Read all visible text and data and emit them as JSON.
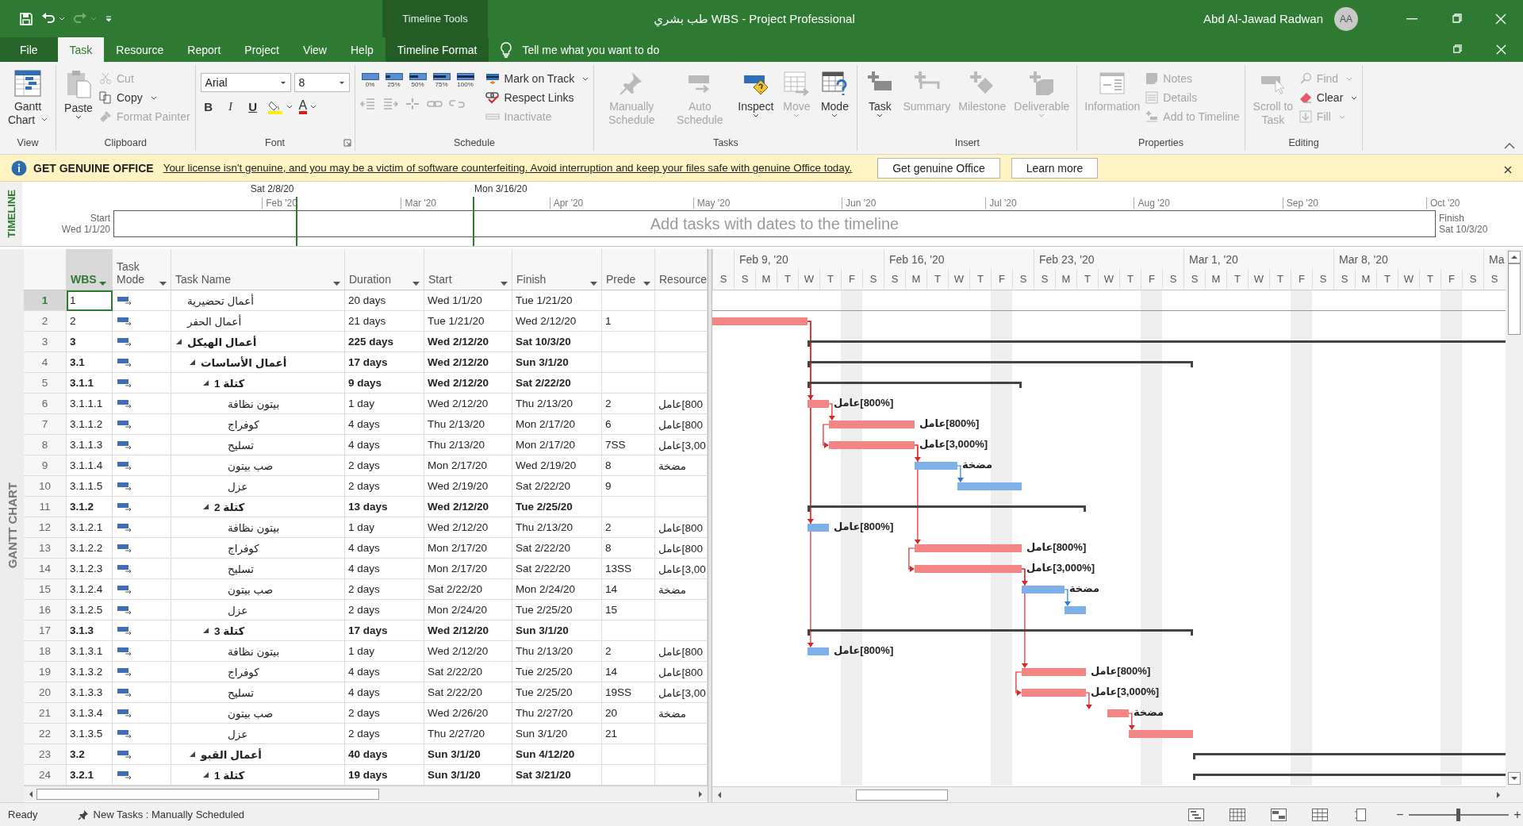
{
  "title_bar": {
    "context_label": "Timeline Tools",
    "title": "طب بشري WBS  -  Project Professional",
    "user": "Abd Al-Jawad Radwan",
    "avatar": "AA"
  },
  "menu_tabs": [
    {
      "label": "File",
      "kind": "file",
      "selected": false
    },
    {
      "label": "Task",
      "kind": "tab",
      "selected": true
    },
    {
      "label": "Resource",
      "kind": "tab",
      "selected": false
    },
    {
      "label": "Report",
      "kind": "tab",
      "selected": false
    },
    {
      "label": "Project",
      "kind": "tab",
      "selected": false
    },
    {
      "label": "View",
      "kind": "tab",
      "selected": false
    },
    {
      "label": "Help",
      "kind": "tab",
      "selected": false
    },
    {
      "label": "Timeline Format",
      "kind": "context",
      "selected": false
    }
  ],
  "tell_me": {
    "placeholder": "Tell me what you want to do"
  },
  "ribbon": {
    "view": {
      "label": "View",
      "gantt_chart": {
        "label": "Gantt Chart",
        "disabled": false
      }
    },
    "clipboard": {
      "label": "Clipboard",
      "paste": {
        "label": "Paste",
        "disabled": false
      },
      "cut": {
        "label": "Cut",
        "disabled": true
      },
      "copy": {
        "label": "Copy",
        "disabled": false
      },
      "format_painter": {
        "label": "Format Painter",
        "disabled": true
      }
    },
    "font": {
      "label": "Font",
      "font_name": {
        "value": "Arial"
      },
      "font_size": {
        "value": "8"
      },
      "bold": {
        "label": "B"
      },
      "italic": {
        "label": "I"
      },
      "underline": {
        "label": "U"
      },
      "font_color": {
        "label": "A"
      }
    },
    "schedule": {
      "label": "Schedule",
      "percent": [
        {
          "label": "0%"
        },
        {
          "label": "25%"
        },
        {
          "label": "50%"
        },
        {
          "label": "75%"
        },
        {
          "label": "100%"
        }
      ],
      "mark_on_track": {
        "label": "Mark on Track",
        "disabled": false
      },
      "respect_links": {
        "label": "Respect Links",
        "disabled": false
      },
      "inactivate": {
        "label": "Inactivate",
        "disabled": true
      },
      "outdent": {
        "disabled": true
      },
      "indent": {
        "disabled": true
      },
      "split": {
        "disabled": true
      },
      "link": {
        "disabled": true
      },
      "unlink": {
        "disabled": true
      }
    },
    "tasks": {
      "label": "Tasks",
      "manually_schedule": {
        "label": "Manually Schedule",
        "disabled": true
      },
      "auto_schedule": {
        "label": "Auto Schedule",
        "disabled": true
      },
      "inspect": {
        "label": "Inspect",
        "disabled": false
      },
      "move": {
        "label": "Move",
        "disabled": true
      },
      "mode": {
        "label": "Mode",
        "disabled": false
      }
    },
    "insert": {
      "label": "Insert",
      "task": {
        "label": "Task",
        "disabled": false
      },
      "summary": {
        "label": "Summary",
        "disabled": true
      },
      "milestone": {
        "label": "Milestone",
        "disabled": true
      },
      "deliverable": {
        "label": "Deliverable",
        "disabled": true
      }
    },
    "properties": {
      "label": "Properties",
      "information": {
        "label": "Information",
        "disabled": true
      },
      "notes": {
        "label": "Notes",
        "disabled": true
      },
      "details": {
        "label": "Details",
        "disabled": true
      },
      "add_to_timeline": {
        "label": "Add to Timeline",
        "disabled": true
      }
    },
    "editing": {
      "label": "Editing",
      "scroll_to_task": {
        "label": "Scroll to Task",
        "disabled": true
      },
      "find": {
        "label": "Find",
        "disabled": true
      },
      "clear": {
        "label": "Clear",
        "disabled": false
      },
      "fill": {
        "label": "Fill",
        "disabled": true
      }
    }
  },
  "banner": {
    "title": "GET GENUINE OFFICE",
    "message": "Your license isn't genuine, and you may be a victim of software counterfeiting. Avoid interruption and keep your files safe with genuine Office today.",
    "buttons": [
      "Get genuine Office",
      "Learn more"
    ]
  },
  "timeline": {
    "side_label": "TIMELINE",
    "start": {
      "label": "Start",
      "date": "Wed 1/1/20"
    },
    "finish": {
      "label": "Finish",
      "date": "Sat 10/3/20"
    },
    "months": [
      "Feb '20",
      "Mar '20",
      "Apr '20",
      "May '20",
      "Jun '20",
      "Jul '20",
      "Aug '20",
      "Sep '20",
      "Oct '20"
    ],
    "view_start": "Sat 2/8/20",
    "view_end": "Mon 3/16/20",
    "placeholder": "Add tasks with dates to the timeline"
  },
  "view_label": "GANTT CHART",
  "columns": [
    {
      "label": "WBS"
    },
    {
      "label": "Task Mode"
    },
    {
      "label": "Task Name"
    },
    {
      "label": "Duration"
    },
    {
      "label": "Start"
    },
    {
      "label": "Finish"
    },
    {
      "label": "Prede"
    },
    {
      "label": "Resource"
    }
  ],
  "tasks": [
    {
      "id": "1",
      "wbs": "1",
      "name": "أعمال تحضيرية",
      "kind": "task",
      "duration": "20 days",
      "start": "Wed 1/1/20",
      "finish": "Tue 1/21/20",
      "selected": true
    },
    {
      "id": "2",
      "wbs": "2",
      "name": "أعمال الحفر",
      "kind": "task",
      "duration": "21 days",
      "start": "Tue 1/21/20",
      "finish": "Wed 2/12/20",
      "pred": "1",
      "critical": true,
      "selected": false
    },
    {
      "id": "3",
      "wbs": "3",
      "name": "أعمال الهيكل",
      "kind": "summary",
      "expanded": true,
      "duration": "225 days",
      "start": "Wed 2/12/20",
      "finish": "Sat 10/3/20",
      "selected": false,
      "children": [
        {
          "id": "4",
          "wbs": "3.1",
          "name": "أعمال الأساسات",
          "kind": "summary",
          "expanded": true,
          "duration": "17 days",
          "start": "Wed 2/12/20",
          "finish": "Sun 3/1/20",
          "selected": false,
          "children": [
            {
              "id": "5",
              "wbs": "3.1.1",
              "name": "كتلة 1",
              "kind": "summary",
              "expanded": true,
              "duration": "9 days",
              "start": "Wed 2/12/20",
              "finish": "Sat 2/22/20",
              "selected": false,
              "children": [
                {
                  "id": "6",
                  "wbs": "3.1.1.1",
                  "name": "بيتون نظافة",
                  "kind": "task",
                  "duration": "1 day",
                  "start": "Wed 2/12/20",
                  "finish": "Thu 2/13/20",
                  "pred": "2",
                  "resource": "800]عامل",
                  "bar_label": "[800%]عامل",
                  "critical": true,
                  "selected": false
                },
                {
                  "id": "7",
                  "wbs": "3.1.1.2",
                  "name": "كوفراج",
                  "kind": "task",
                  "duration": "4 days",
                  "start": "Thu 2/13/20",
                  "finish": "Mon 2/17/20",
                  "pred": "6",
                  "resource": "800]عامل",
                  "bar_label": "[800%]عامل",
                  "critical": true,
                  "selected": false
                },
                {
                  "id": "8",
                  "wbs": "3.1.1.3",
                  "name": "تسليح",
                  "kind": "task",
                  "duration": "4 days",
                  "start": "Thu 2/13/20",
                  "finish": "Mon 2/17/20",
                  "pred": "7SS",
                  "resource": "3,00]عامل",
                  "bar_label": "[3,000%]عامل",
                  "critical": true,
                  "selected": false
                },
                {
                  "id": "9",
                  "wbs": "3.1.1.4",
                  "name": "صب بيتون",
                  "kind": "task",
                  "duration": "2 days",
                  "start": "Mon 2/17/20",
                  "finish": "Wed 2/19/20",
                  "pred": "8",
                  "resource": "مضخة",
                  "bar_label": "مضخة",
                  "critical": false,
                  "selected": false
                },
                {
                  "id": "10",
                  "wbs": "3.1.1.5",
                  "name": "عزل",
                  "kind": "task",
                  "duration": "2 days",
                  "start": "Wed 2/19/20",
                  "finish": "Sat 2/22/20",
                  "pred": "9",
                  "critical": false,
                  "selected": false
                }
              ]
            },
            {
              "id": "11",
              "wbs": "3.1.2",
              "name": "كتلة 2",
              "kind": "summary",
              "expanded": true,
              "duration": "13 days",
              "start": "Wed 2/12/20",
              "finish": "Tue 2/25/20",
              "selected": false,
              "children": [
                {
                  "id": "12",
                  "wbs": "3.1.2.1",
                  "name": "بيتون نظافة",
                  "kind": "task",
                  "duration": "1 day",
                  "start": "Wed 2/12/20",
                  "finish": "Thu 2/13/20",
                  "pred": "2",
                  "resource": "800]عامل",
                  "bar_label": "[800%]عامل",
                  "critical": false,
                  "selected": false
                },
                {
                  "id": "13",
                  "wbs": "3.1.2.2",
                  "name": "كوفراج",
                  "kind": "task",
                  "duration": "4 days",
                  "start": "Mon 2/17/20",
                  "finish": "Sat 2/22/20",
                  "pred": "8",
                  "resource": "800]عامل",
                  "bar_label": "[800%]عامل",
                  "critical": true,
                  "selected": false
                },
                {
                  "id": "14",
                  "wbs": "3.1.2.3",
                  "name": "تسليح",
                  "kind": "task",
                  "duration": "4 days",
                  "start": "Mon 2/17/20",
                  "finish": "Sat 2/22/20",
                  "pred": "13SS",
                  "resource": "3,00]عامل",
                  "bar_label": "[3,000%]عامل",
                  "critical": true,
                  "selected": false
                },
                {
                  "id": "15",
                  "wbs": "3.1.2.4",
                  "name": "صب بيتون",
                  "kind": "task",
                  "duration": "2 days",
                  "start": "Sat 2/22/20",
                  "finish": "Mon 2/24/20",
                  "pred": "14",
                  "resource": "مضخة",
                  "bar_label": "مضخة",
                  "critical": false,
                  "selected": false
                },
                {
                  "id": "16",
                  "wbs": "3.1.2.5",
                  "name": "عزل",
                  "kind": "task",
                  "duration": "2 days",
                  "start": "Mon 2/24/20",
                  "finish": "Tue 2/25/20",
                  "pred": "15",
                  "critical": false,
                  "selected": false
                }
              ]
            },
            {
              "id": "17",
              "wbs": "3.1.3",
              "name": "كتلة 3",
              "kind": "summary",
              "expanded": true,
              "duration": "17 days",
              "start": "Wed 2/12/20",
              "finish": "Sun 3/1/20",
              "selected": false,
              "children": [
                {
                  "id": "18",
                  "wbs": "3.1.3.1",
                  "name": "بيتون نظافة",
                  "kind": "task",
                  "duration": "1 day",
                  "start": "Wed 2/12/20",
                  "finish": "Thu 2/13/20",
                  "pred": "2",
                  "resource": "800]عامل",
                  "bar_label": "[800%]عامل",
                  "critical": false,
                  "selected": false
                },
                {
                  "id": "19",
                  "wbs": "3.1.3.2",
                  "name": "كوفراج",
                  "kind": "task",
                  "duration": "4 days",
                  "start": "Sat 2/22/20",
                  "finish": "Tue 2/25/20",
                  "pred": "14",
                  "resource": "800]عامل",
                  "bar_label": "[800%]عامل",
                  "critical": true,
                  "selected": false
                },
                {
                  "id": "20",
                  "wbs": "3.1.3.3",
                  "name": "تسليح",
                  "kind": "task",
                  "duration": "4 days",
                  "start": "Sat 2/22/20",
                  "finish": "Tue 2/25/20",
                  "pred": "19SS",
                  "resource": "3,00]عامل",
                  "bar_label": "[3,000%]عامل",
                  "critical": true,
                  "selected": false
                },
                {
                  "id": "21",
                  "wbs": "3.1.3.4",
                  "name": "صب بيتون",
                  "kind": "task",
                  "duration": "2 days",
                  "start": "Wed 2/26/20",
                  "finish": "Thu 2/27/20",
                  "pred": "20",
                  "resource": "مضخة",
                  "bar_label": "مضخة",
                  "critical": true,
                  "selected": false
                },
                {
                  "id": "22",
                  "wbs": "3.1.3.5",
                  "name": "عزل",
                  "kind": "task",
                  "duration": "2 days",
                  "start": "Thu 2/27/20",
                  "finish": "Sun 3/1/20",
                  "pred": "21",
                  "critical": true,
                  "selected": false
                }
              ]
            }
          ]
        },
        {
          "id": "23",
          "wbs": "3.2",
          "name": "أعمال القبو",
          "kind": "summary",
          "expanded": true,
          "duration": "40 days",
          "start": "Sun 3/1/20",
          "finish": "Sun 4/12/20",
          "selected": false,
          "children": [
            {
              "id": "24",
              "wbs": "3.2.1",
              "name": "كتلة 1",
              "kind": "summary",
              "expanded": true,
              "duration": "19 days",
              "start": "Sun 3/1/20",
              "finish": "Sat 3/21/20",
              "selected": false
            }
          ]
        }
      ]
    }
  ],
  "gantt": {
    "weeks": [
      "Feb 9, '20",
      "Feb 16, '20",
      "Feb 23, '20",
      "Mar 1, '20",
      "Mar 8, '20",
      "Ma"
    ],
    "days": [
      {
        "label": "S",
        "nonworking": false
      },
      {
        "label": "S",
        "nonworking": false
      },
      {
        "label": "M",
        "nonworking": false
      },
      {
        "label": "T",
        "nonworking": false
      },
      {
        "label": "W",
        "nonworking": false
      },
      {
        "label": "T",
        "nonworking": false
      },
      {
        "label": "F",
        "nonworking": true
      },
      {
        "label": "S",
        "nonworking": false
      },
      {
        "label": "S",
        "nonworking": false
      },
      {
        "label": "M",
        "nonworking": false
      },
      {
        "label": "T",
        "nonworking": false
      },
      {
        "label": "W",
        "nonworking": false
      },
      {
        "label": "T",
        "nonworking": false
      },
      {
        "label": "F",
        "nonworking": true
      },
      {
        "label": "S",
        "nonworking": false
      },
      {
        "label": "S",
        "nonworking": false
      },
      {
        "label": "M",
        "nonworking": false
      },
      {
        "label": "T",
        "nonworking": false
      },
      {
        "label": "W",
        "nonworking": false
      },
      {
        "label": "T",
        "nonworking": false
      },
      {
        "label": "F",
        "nonworking": true
      },
      {
        "label": "S",
        "nonworking": false
      },
      {
        "label": "S",
        "nonworking": false
      },
      {
        "label": "M",
        "nonworking": false
      },
      {
        "label": "T",
        "nonworking": false
      },
      {
        "label": "W",
        "nonworking": false
      },
      {
        "label": "T",
        "nonworking": false
      },
      {
        "label": "F",
        "nonworking": true
      },
      {
        "label": "S",
        "nonworking": false
      },
      {
        "label": "S",
        "nonworking": false
      },
      {
        "label": "M",
        "nonworking": false
      },
      {
        "label": "T",
        "nonworking": false
      },
      {
        "label": "W",
        "nonworking": false
      },
      {
        "label": "T",
        "nonworking": false
      },
      {
        "label": "F",
        "nonworking": true
      },
      {
        "label": "S",
        "nonworking": false
      },
      {
        "label": "S",
        "nonworking": false
      }
    ]
  },
  "status_bar": {
    "ready": "Ready",
    "new_tasks": "New Tasks : Manually Scheduled",
    "zoom_out": "−",
    "zoom_in": "+",
    "zoom": {
      "level": 0.49
    }
  }
}
